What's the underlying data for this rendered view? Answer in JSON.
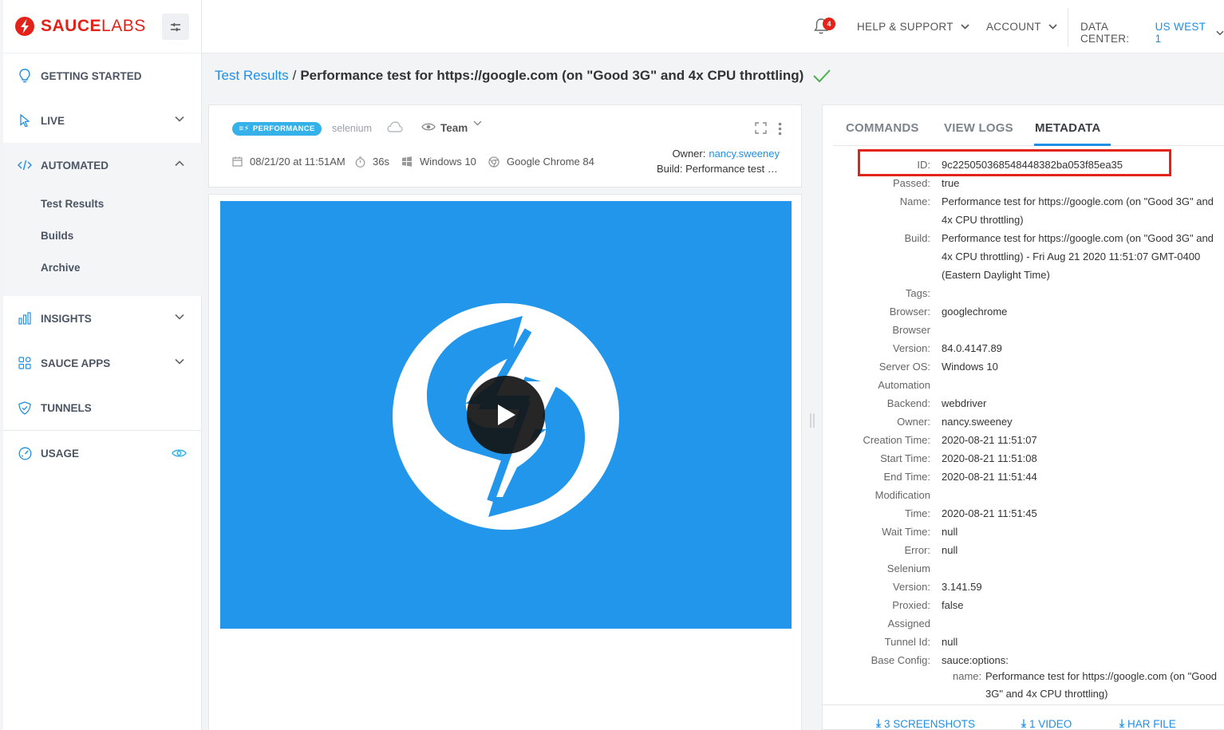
{
  "brand": {
    "name_bold": "SAUCE",
    "name_light": "LABS",
    "color": "#e2231a"
  },
  "sidebar": {
    "items": [
      {
        "label": "GETTING STARTED",
        "icon": "bulb-icon"
      },
      {
        "label": "LIVE",
        "icon": "cursor-icon"
      },
      {
        "label": "AUTOMATED",
        "icon": "code-icon"
      },
      {
        "label": "INSIGHTS",
        "icon": "bar-chart-icon"
      },
      {
        "label": "SAUCE APPS",
        "icon": "apps-grid-icon"
      },
      {
        "label": "TUNNELS",
        "icon": "shield-icon"
      },
      {
        "label": "USAGE",
        "icon": "gauge-icon"
      }
    ],
    "automated_sub": [
      "Test Results",
      "Builds",
      "Archive"
    ]
  },
  "header": {
    "notifications": "4",
    "help": "HELP & SUPPORT",
    "account": "ACCOUNT",
    "data_center_label": "DATA CENTER:",
    "data_center_value": "US WEST 1"
  },
  "breadcrumb": {
    "link": "Test Results",
    "separator": "/",
    "title": "Performance test for https://google.com (on \"Good 3G\" and 4x CPU throttling)"
  },
  "test": {
    "badge": "PERFORMANCE",
    "framework": "selenium",
    "visibility": "Team",
    "date": "08/21/20 at 11:51AM",
    "duration": "36s",
    "os": "Windows 10",
    "browser": "Google Chrome 84",
    "owner_label": "Owner:",
    "owner": "nancy.sweeney",
    "build": "Build: Performance test for https://google.com"
  },
  "panel": {
    "tabs": [
      "COMMANDS",
      "VIEW LOGS",
      "METADATA"
    ],
    "active_tab": "METADATA",
    "keys": {
      "id": "ID:",
      "passed": "Passed:",
      "name": "Name:",
      "build": "Build:",
      "tags": "Tags:",
      "browser": "Browser:",
      "browser_version_1": "Browser",
      "browser_version_2": "Version:",
      "server_os": "Server OS:",
      "backend_1": "Automation",
      "backend_2": "Backend:",
      "owner": "Owner:",
      "creation": "Creation Time:",
      "start": "Start Time:",
      "end": "End Time:",
      "mod_1": "Modification",
      "mod_2": "Time:",
      "wait": "Wait Time:",
      "error": "Error:",
      "sel_1": "Selenium",
      "sel_2": "Version:",
      "proxied": "Proxied:",
      "tunnel_1": "Assigned",
      "tunnel_2": "Tunnel Id:",
      "base": "Base Config:"
    },
    "values": {
      "id": "9c225050368548448382ba053f85ea35",
      "passed": "true",
      "name_1": "Performance test for https://google.com (on \"Good 3G\" and",
      "name_2": "4x CPU throttling)",
      "build_1": "Performance test for https://google.com (on \"Good 3G\" and",
      "build_2": "4x CPU throttling) - Fri Aug 21 2020 11:51:07 GMT-0400",
      "build_3": "(Eastern Daylight Time)",
      "tags": "",
      "browser": "googlechrome",
      "browser_version": "84.0.4147.89",
      "server_os": "Windows 10",
      "backend": "webdriver",
      "owner": "nancy.sweeney",
      "creation": "2020-08-21 11:51:07",
      "start": "2020-08-21 11:51:08",
      "end": "2020-08-21 11:51:44",
      "modification": "2020-08-21 11:51:45",
      "wait": "null",
      "error": "null",
      "selenium_version": "3.141.59",
      "proxied": "false",
      "tunnel": "null",
      "base_config": "sauce:options:",
      "base_name_key": "name:",
      "base_name_val": "Performance test for https://google.com (on \"Good",
      "base_name_val_2": "3G\" and 4x CPU throttling)"
    },
    "downloads": [
      "3 SCREENSHOTS",
      "1 VIDEO",
      "HAR FILE"
    ]
  },
  "colors": {
    "accent": "#1f8fe6",
    "video_bg": "#2196ea",
    "success": "#4caf50",
    "badge": "#33b1e8"
  }
}
